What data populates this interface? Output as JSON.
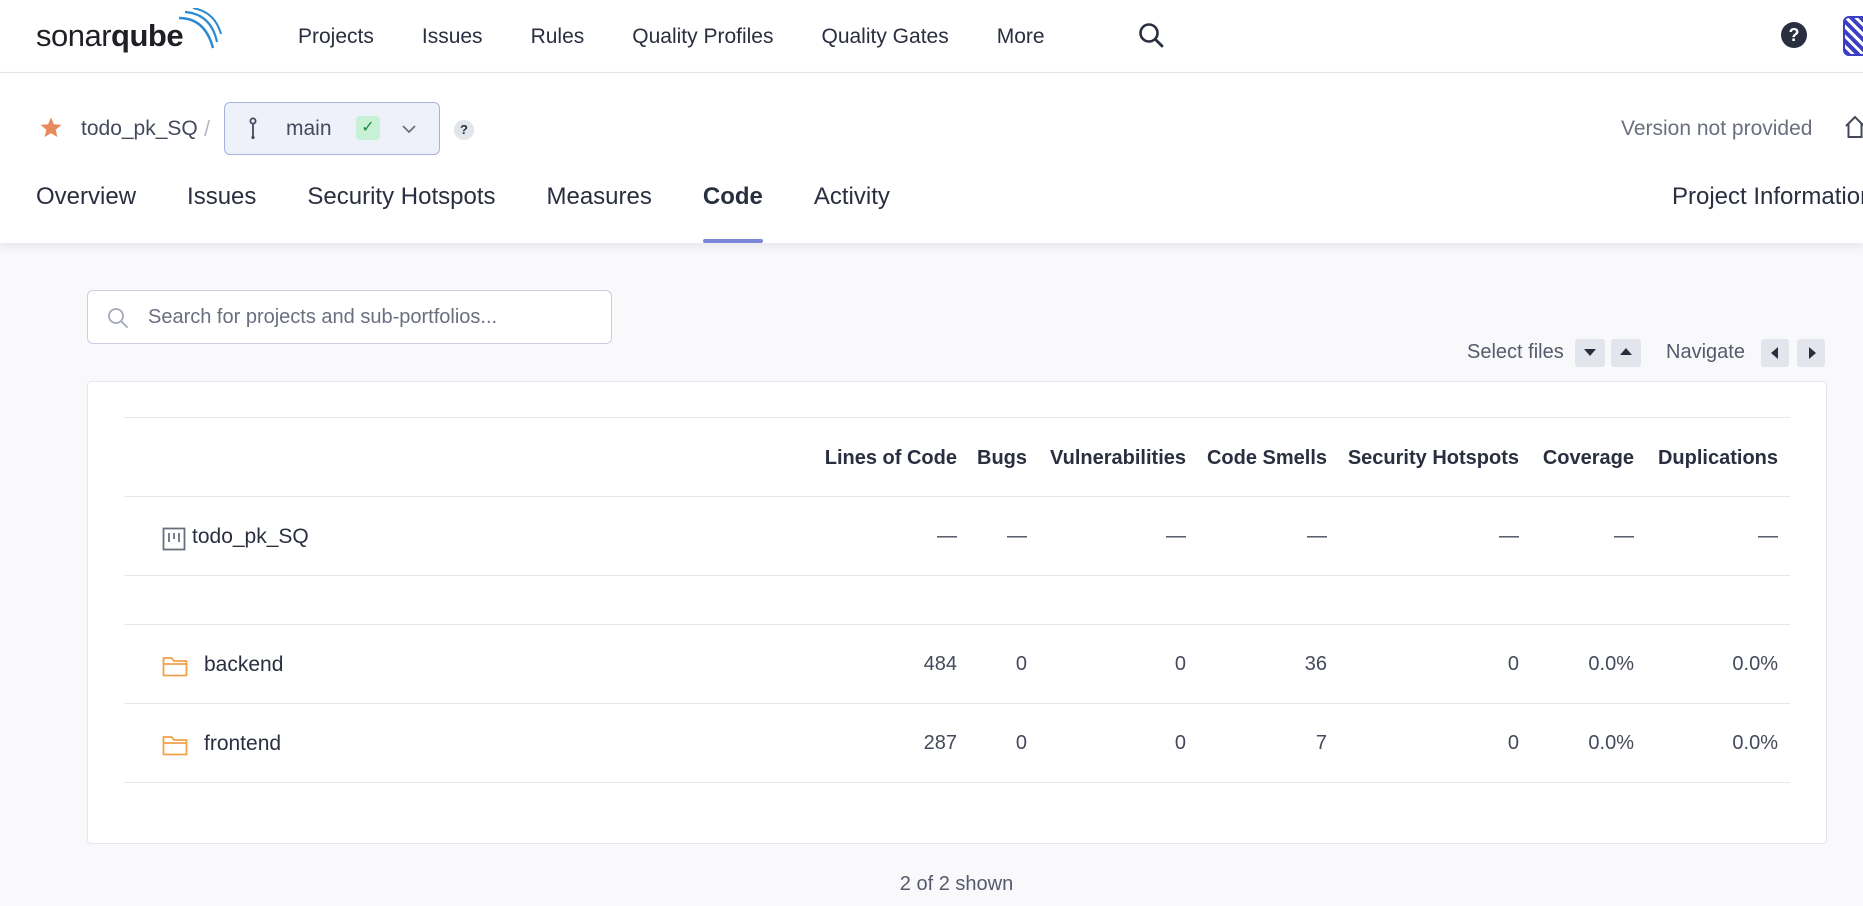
{
  "app": {
    "logo_regular": "sonar",
    "logo_bold": "qube"
  },
  "topnav": {
    "items": [
      "Projects",
      "Issues",
      "Rules",
      "Quality Profiles",
      "Quality Gates",
      "More"
    ],
    "help_label": "?"
  },
  "project": {
    "name": "todo_pk_SQ",
    "separator": "/",
    "branch": "main",
    "branch_status_glyph": "✓",
    "branch_help": "?",
    "version": "Version not provided",
    "tabs": [
      "Overview",
      "Issues",
      "Security Hotspots",
      "Measures",
      "Code",
      "Activity"
    ],
    "active_tab": "Code",
    "project_information": "Project Information"
  },
  "search": {
    "placeholder": "Search for projects and sub-portfolios..."
  },
  "toolbar": {
    "select_files": "Select files",
    "navigate": "Navigate"
  },
  "table": {
    "columns": [
      "Lines of Code",
      "Bugs",
      "Vulnerabilities",
      "Code Smells",
      "Security Hotspots",
      "Coverage",
      "Duplications"
    ],
    "root": {
      "name": "todo_pk_SQ",
      "values": [
        "—",
        "—",
        "—",
        "—",
        "—",
        "—",
        "—"
      ]
    },
    "rows": [
      {
        "name": "backend",
        "values": [
          "484",
          "0",
          "0",
          "36",
          "0",
          "0.0%",
          "0.0%"
        ]
      },
      {
        "name": "frontend",
        "values": [
          "287",
          "0",
          "0",
          "7",
          "0",
          "0.0%",
          "0.0%"
        ]
      }
    ]
  },
  "footer": {
    "shown": "2 of 2 shown"
  },
  "colors": {
    "accent": "#7b86d8",
    "folder": "#f0a14a",
    "star": "#e88a5c",
    "success": "#1f8a40"
  }
}
